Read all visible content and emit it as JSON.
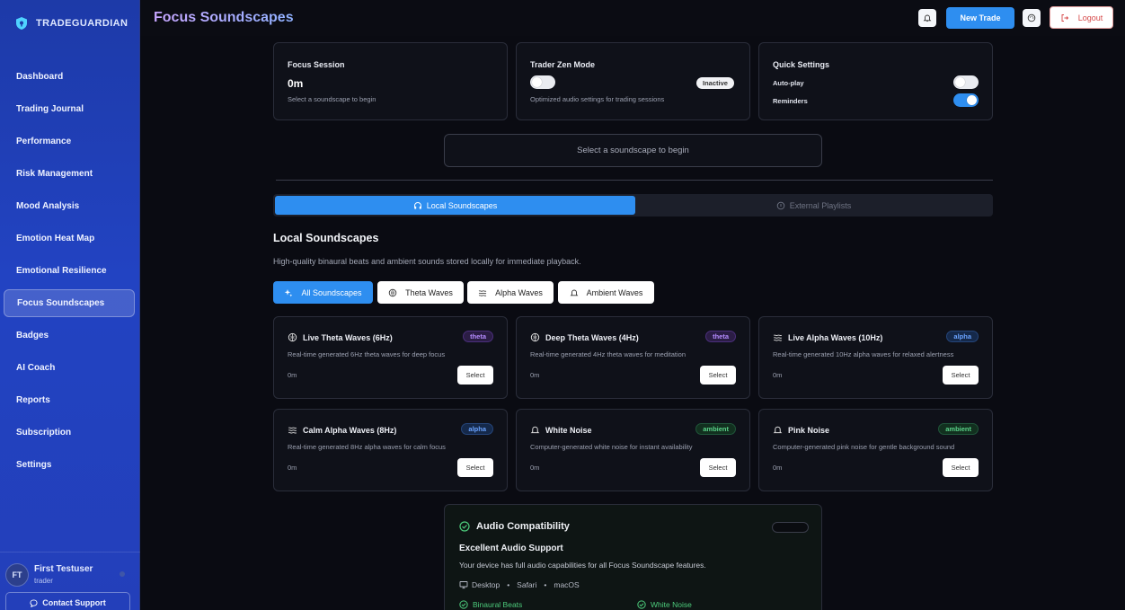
{
  "brand": {
    "name": "TRADEGUARDIAN"
  },
  "sidebar": {
    "items": [
      {
        "label": "Dashboard",
        "active": false
      },
      {
        "label": "Trading Journal",
        "active": false
      },
      {
        "label": "Performance",
        "active": false
      },
      {
        "label": "Risk Management",
        "active": false
      },
      {
        "label": "Mood Analysis",
        "active": false
      },
      {
        "label": "Emotion Heat Map",
        "active": false
      },
      {
        "label": "Emotional Resilience",
        "active": false
      },
      {
        "label": "Focus Soundscapes",
        "active": true
      },
      {
        "label": "Badges",
        "active": false
      },
      {
        "label": "AI Coach",
        "active": false
      },
      {
        "label": "Reports",
        "active": false
      },
      {
        "label": "Subscription",
        "active": false
      },
      {
        "label": "Settings",
        "active": false
      }
    ]
  },
  "user": {
    "initials": "FT",
    "name": "First Testuser",
    "role": "trader"
  },
  "support": {
    "label": "Contact Support"
  },
  "header": {
    "title": "Focus Soundscapes",
    "new_trade": "New Trade",
    "logout": "Logout"
  },
  "focus_session": {
    "title": "Focus Session",
    "value": "0m",
    "hint": "Select a soundscape to begin"
  },
  "zen_mode": {
    "title": "Trader Zen Mode",
    "status": "Inactive",
    "desc": "Optimized audio settings for trading sessions",
    "enabled": false
  },
  "quick_settings": {
    "title": "Quick Settings",
    "autoplay_label": "Auto-play",
    "autoplay": false,
    "reminders_label": "Reminders",
    "reminders": true
  },
  "player": {
    "placeholder": "Select a soundscape to begin"
  },
  "tabs": {
    "local": "Local Soundscapes",
    "external": "External Playlists"
  },
  "section": {
    "title": "Local Soundscapes",
    "desc": "High-quality binaural beats and ambient sounds stored locally for immediate playback."
  },
  "filters": {
    "all": "All Soundscapes",
    "theta": "Theta Waves",
    "alpha": "Alpha Waves",
    "ambient": "Ambient Waves"
  },
  "soundscapes": [
    {
      "name": "Live Theta Waves (6Hz)",
      "badge": "theta",
      "desc": "Real-time generated 6Hz theta waves for deep focus",
      "duration": "0m",
      "action": "Select"
    },
    {
      "name": "Deep Theta Waves (4Hz)",
      "badge": "theta",
      "desc": "Real-time generated 4Hz theta waves for meditation",
      "duration": "0m",
      "action": "Select"
    },
    {
      "name": "Live Alpha Waves (10Hz)",
      "badge": "alpha",
      "desc": "Real-time generated 10Hz alpha waves for relaxed alertness",
      "duration": "0m",
      "action": "Select"
    },
    {
      "name": "Calm Alpha Waves (8Hz)",
      "badge": "alpha",
      "desc": "Real-time generated 8Hz alpha waves for calm focus",
      "duration": "0m",
      "action": "Select"
    },
    {
      "name": "White Noise",
      "badge": "ambient",
      "desc": "Computer-generated white noise for instant availability",
      "duration": "0m",
      "action": "Select"
    },
    {
      "name": "Pink Noise",
      "badge": "ambient",
      "desc": "Computer-generated pink noise for gentle background sound",
      "duration": "0m",
      "action": "Select"
    }
  ],
  "audio": {
    "title": "Audio Compatibility",
    "support_title": "Excellent Audio Support",
    "support_desc": "Your device has full audio capabilities for all Focus Soundscape features.",
    "device": "Desktop",
    "browser": "Safari",
    "os": "macOS",
    "feature1": "Binaural Beats",
    "feature2": "White Noise"
  },
  "colors": {
    "accent": "#2e8ef0",
    "theta": "#b58cff",
    "alpha": "#6aa3ff",
    "ambient": "#5bd38a",
    "sidebar": "#2243c2"
  }
}
